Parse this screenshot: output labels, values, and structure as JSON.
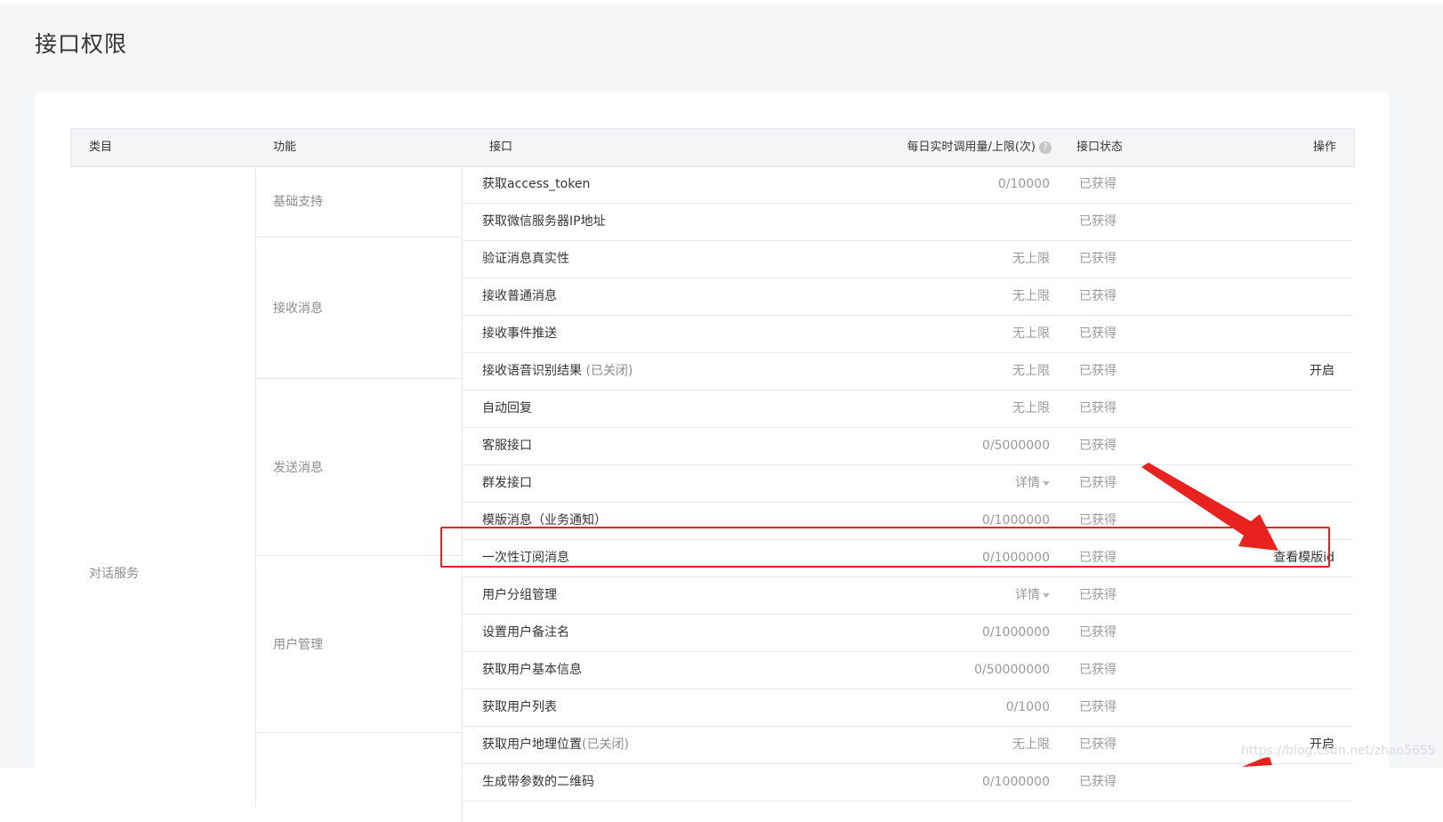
{
  "page": {
    "title": "接口权限"
  },
  "table": {
    "headers": {
      "category": "类目",
      "function": "功能",
      "api": "接口",
      "quota": "每日实时调用量/上限(次)",
      "status": "接口状态",
      "action": "操作"
    },
    "category": "对话服务",
    "groups": [
      "基础支持",
      "接收消息",
      "发送消息",
      "用户管理"
    ],
    "rows": [
      {
        "api": "获取access_token",
        "quota": "0/10000",
        "status": "已获得",
        "action": ""
      },
      {
        "api": "获取微信服务器IP地址",
        "quota": "",
        "status": "已获得",
        "action": ""
      },
      {
        "api": "验证消息真实性",
        "quota": "无上限",
        "status": "已获得",
        "action": ""
      },
      {
        "api": "接收普通消息",
        "quota": "无上限",
        "status": "已获得",
        "action": ""
      },
      {
        "api": "接收事件推送",
        "quota": "无上限",
        "status": "已获得",
        "action": ""
      },
      {
        "api": "接收语音识别结果",
        "api_suffix": " (已关闭)",
        "quota": "无上限",
        "status": "已获得",
        "action": "开启"
      },
      {
        "api": "自动回复",
        "quota": "无上限",
        "status": "已获得",
        "action": ""
      },
      {
        "api": "客服接口",
        "quota": "0/5000000",
        "status": "已获得",
        "action": ""
      },
      {
        "api": "群发接口",
        "quota": "详情",
        "status": "已获得",
        "action": ""
      },
      {
        "api": "模版消息（业务通知）",
        "quota": "0/1000000",
        "status": "已获得",
        "action": ""
      },
      {
        "api": "一次性订阅消息",
        "quota": "0/1000000",
        "status": "已获得",
        "action": "查看模版id"
      },
      {
        "api": "用户分组管理",
        "quota": "详情",
        "status": "已获得",
        "action": ""
      },
      {
        "api": "设置用户备注名",
        "quota": "0/1000000",
        "status": "已获得",
        "action": ""
      },
      {
        "api": "获取用户基本信息",
        "quota": "0/50000000",
        "status": "已获得",
        "action": ""
      },
      {
        "api": "获取用户列表",
        "quota": "0/1000",
        "status": "已获得",
        "action": ""
      },
      {
        "api": "获取用户地理位置",
        "api_suffix": "(已关闭)",
        "quota": "无上限",
        "status": "已获得",
        "action": "开启"
      },
      {
        "api": "生成带参数的二维码",
        "quota": "0/1000000",
        "status": "已获得",
        "action": ""
      }
    ]
  },
  "watermark": "https://blog.csdn.net/zhao5655",
  "colors": {
    "highlight": "#e8231f",
    "arrow": "#e8231f",
    "header_bg": "#f3f5f7",
    "page_bg": "#f5f6f7"
  }
}
